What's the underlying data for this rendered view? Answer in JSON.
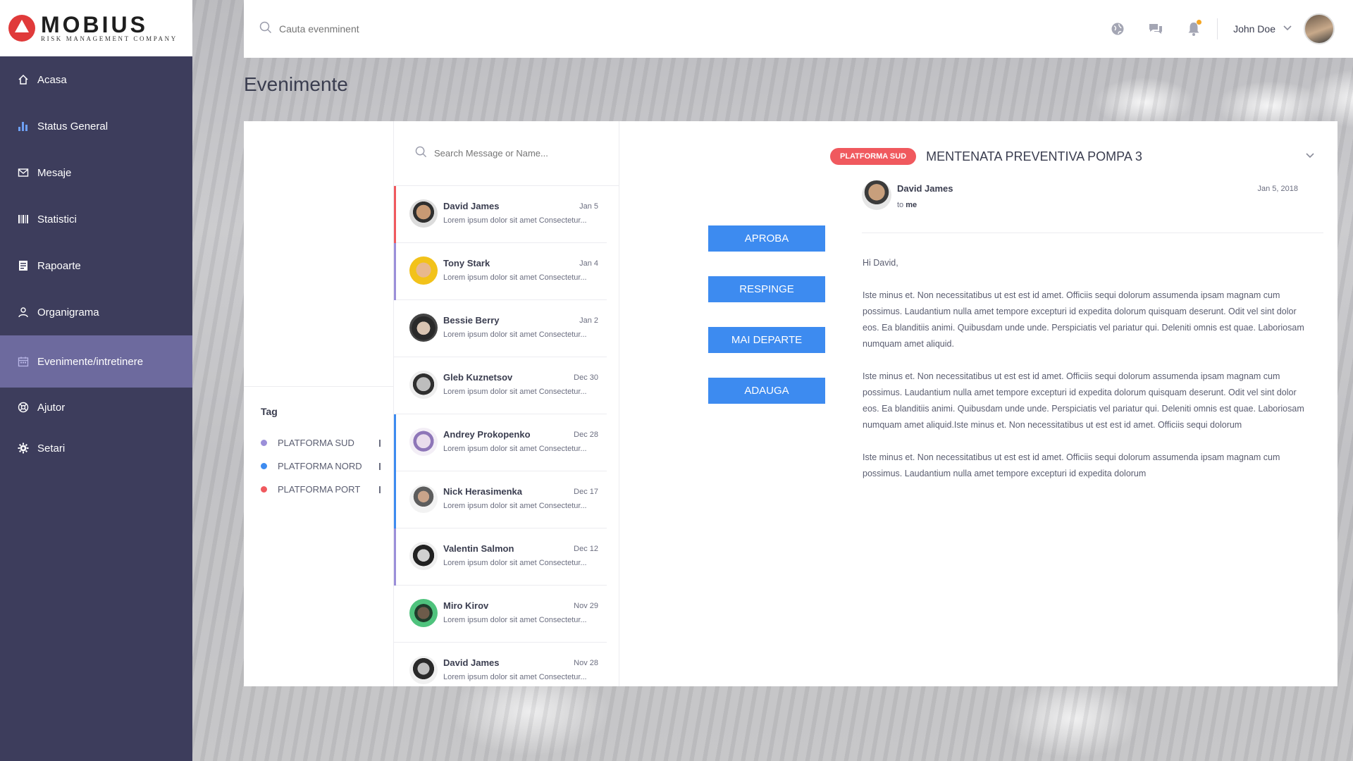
{
  "brand": {
    "title": "MOBIUS",
    "subtitle": "RISK MANAGEMENT COMPANY",
    "logo_color": "#e03a3a"
  },
  "sidebar": {
    "items": [
      {
        "label": "Acasa",
        "icon": "home-icon"
      },
      {
        "label": "Status General",
        "icon": "bar-chart-icon"
      },
      {
        "label": "Mesaje",
        "icon": "mail-icon"
      },
      {
        "label": "Statistici",
        "icon": "barcode-icon"
      },
      {
        "label": "Rapoarte",
        "icon": "report-icon"
      },
      {
        "label": "Organigrama",
        "icon": "user-icon"
      },
      {
        "label": "Evenimente/intretinere",
        "icon": "calendar-icon",
        "active": true
      },
      {
        "label": "Ajutor",
        "icon": "help-icon"
      },
      {
        "label": "Setari",
        "icon": "gear-icon"
      }
    ],
    "bg_color": "#3d3d5c",
    "active_color": "#6d6a9e"
  },
  "topbar": {
    "search_placeholder": "Cauta evenminent",
    "user_name": "John Doe",
    "notification_dot_color": "#f5a623"
  },
  "page": {
    "title": "Evenimente"
  },
  "tags": {
    "title": "Tag",
    "items": [
      {
        "label": "PLATFORMA SUD",
        "color": "#9b8fd9"
      },
      {
        "label": "PLATFORMA NORD",
        "color": "#3d8bf0"
      },
      {
        "label": "PLATFORMA PORT",
        "color": "#f0595e"
      }
    ]
  },
  "messages": {
    "search_placeholder": "Search Message or Name...",
    "items": [
      {
        "name": "David James",
        "date": "Jan 5",
        "preview": "Lorem ipsum dolor sit amet Consectetur...",
        "accent": "#f0595e"
      },
      {
        "name": "Tony Stark",
        "date": "Jan 4",
        "preview": "Lorem ipsum dolor sit amet Consectetur...",
        "accent": "#9b8fd9"
      },
      {
        "name": "Bessie Berry",
        "date": "Jan 2",
        "preview": "Lorem ipsum dolor sit amet Consectetur...",
        "accent": ""
      },
      {
        "name": "Gleb Kuznetsov",
        "date": "Dec 30",
        "preview": "Lorem ipsum dolor sit amet Consectetur...",
        "accent": ""
      },
      {
        "name": "Andrey Prokopenko",
        "date": "Dec 28",
        "preview": "Lorem ipsum dolor sit amet Consectetur...",
        "accent": "#3d8bf0"
      },
      {
        "name": "Nick Herasimenka",
        "date": "Dec 17",
        "preview": "Lorem ipsum dolor sit amet Consectetur...",
        "accent": "#3d8bf0"
      },
      {
        "name": "Valentin Salmon",
        "date": "Dec 12",
        "preview": "Lorem ipsum dolor sit amet Consectetur...",
        "accent": "#9b8fd9"
      },
      {
        "name": "Miro Kirov",
        "date": "Nov 29",
        "preview": "Lorem ipsum dolor sit amet Consectetur...",
        "accent": ""
      },
      {
        "name": "David James",
        "date": "Nov 28",
        "preview": "Lorem ipsum dolor sit amet Consectetur...",
        "accent": ""
      }
    ]
  },
  "actions": {
    "approve": "APROBA",
    "reject": "RESPINGE",
    "forward": "MAI DEPARTE",
    "add": "ADAUGA",
    "color": "#3d8bf0"
  },
  "detail": {
    "badge": "PLATFORMA SUD",
    "badge_color": "#f0595e",
    "subject": "MENTENATA PREVENTIVA POMPA 3",
    "sender": "David James",
    "to_prefix": "to",
    "to": "me",
    "date": "Jan 5, 2018",
    "greeting": "Hi David,",
    "paragraphs": [
      "Iste minus et. Non necessitatibus ut est est id amet. Officiis sequi dolorum assumenda ipsam magnam cum possimus. Laudantium nulla amet tempore excepturi id expedita dolorum quisquam deserunt. Odit vel sint dolor eos. Ea blanditiis animi. Quibusdam unde unde. Perspiciatis vel pariatur qui. Deleniti omnis est quae. Laboriosam numquam amet aliquid.",
      "Iste minus et. Non necessitatibus ut est est id amet. Officiis sequi dolorum assumenda ipsam magnam cum possimus. Laudantium nulla amet tempore excepturi id expedita dolorum quisquam deserunt. Odit vel sint dolor eos. Ea blanditiis animi. Quibusdam unde unde. Perspiciatis vel pariatur qui. Deleniti omnis est quae. Laboriosam numquam amet aliquid.Iste minus et. Non necessitatibus ut est est id amet. Officiis sequi dolorum",
      "Iste minus et. Non necessitatibus ut est est id amet. Officiis sequi dolorum assumenda ipsam magnam cum possimus. Laudantium nulla amet tempore excepturi id expedita dolorum"
    ]
  }
}
